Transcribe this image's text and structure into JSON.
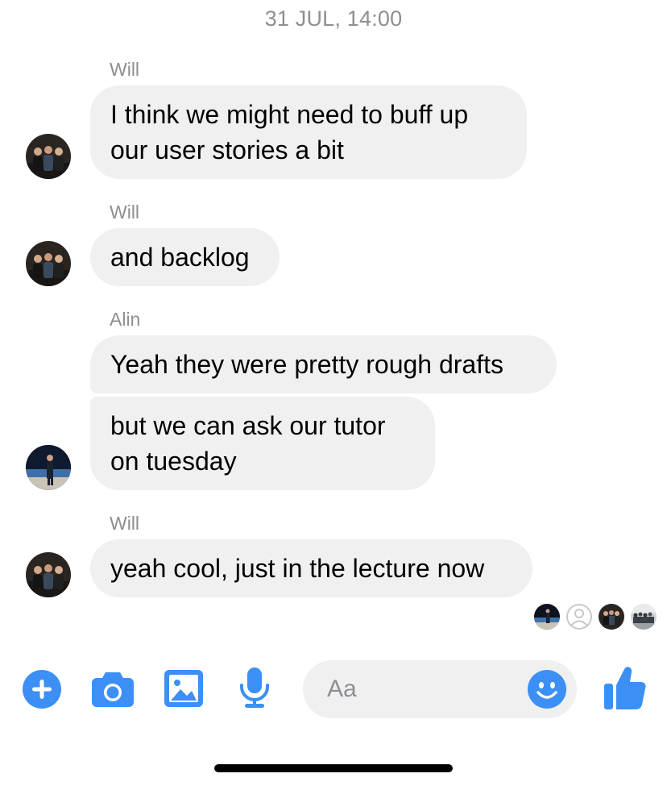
{
  "timestamp": "31 JUL, 14:00",
  "messages": [
    {
      "sender": "Will",
      "lines": [
        "I think we might need to buff up",
        "our user stories a bit"
      ]
    },
    {
      "sender": "Will",
      "lines": [
        "and backlog"
      ]
    },
    {
      "sender": "Alin",
      "lines": [
        "Yeah they were pretty rough drafts"
      ]
    },
    {
      "sender": "Alin",
      "lines": [
        "but we can ask our tutor",
        "on tuesday"
      ]
    },
    {
      "sender": "Will",
      "lines": [
        "yeah cool, just in the lecture now"
      ]
    }
  ],
  "composer": {
    "placeholder": "Aa"
  },
  "toolbar": {
    "icons": [
      "plus-icon",
      "camera-icon",
      "image-icon",
      "microphone-icon",
      "emoji-icon",
      "thumbs-up-icon"
    ]
  },
  "colors": {
    "accent": "#3b8ff5",
    "bubble": "#f0f0f0",
    "meta_text": "#8e8e93"
  }
}
